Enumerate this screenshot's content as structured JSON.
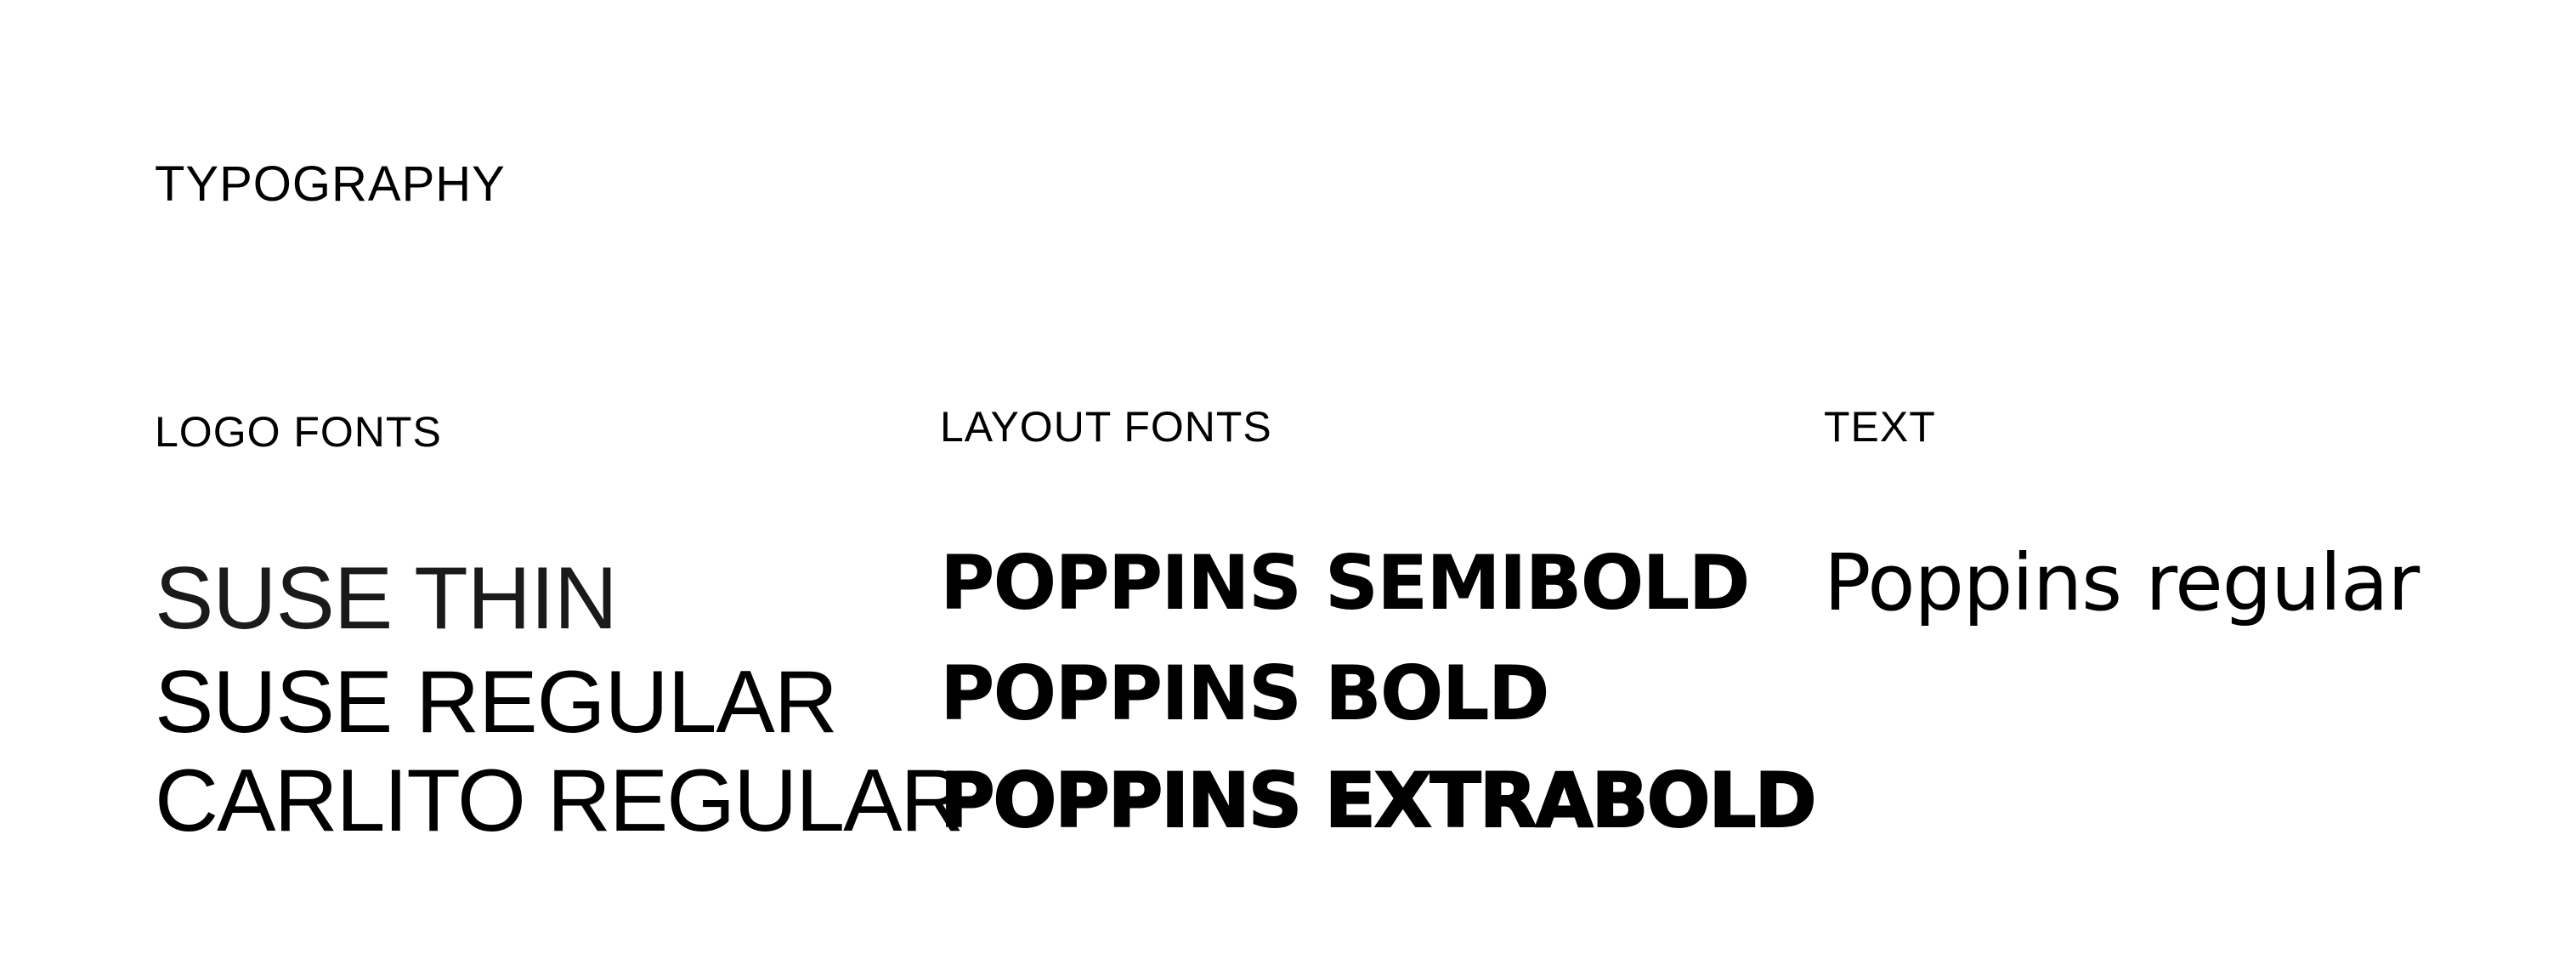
{
  "title": "TYPOGRAPHY",
  "sections": {
    "logo": {
      "heading": "LOGO FONTS",
      "samples": [
        "SUSE THIN",
        "SUSE REGULAR",
        "CARLITO REGULAR"
      ]
    },
    "layout": {
      "heading": "LAYOUT FONTS",
      "samples": [
        "POPPINS SEMIBOLD",
        "POPPINS BOLD",
        "POPPINS EXTRABOLD"
      ]
    },
    "text": {
      "heading": "TEXT",
      "samples": [
        "Poppins regular"
      ]
    }
  },
  "colors": {
    "background": "#ffffff",
    "text": "#000000"
  }
}
